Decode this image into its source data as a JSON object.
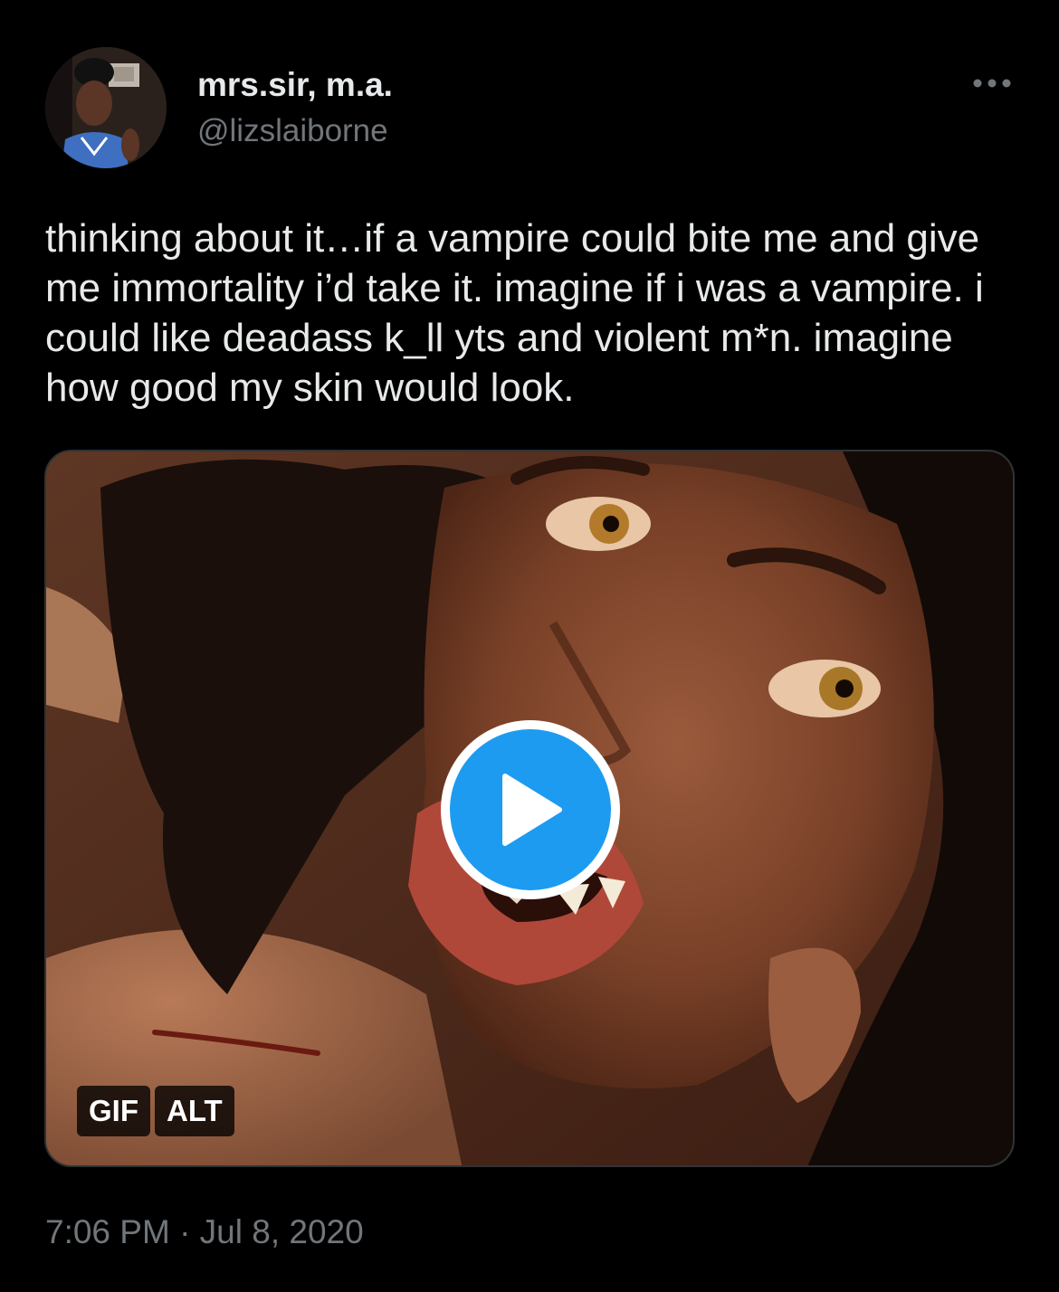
{
  "author": {
    "display_name": "mrs.sir, m.a.",
    "handle": "@lizslaiborne",
    "avatar_icon": "profile-photo"
  },
  "more_menu_icon": "more-horizontal-icon",
  "tweet": {
    "text": "thinking about it…if a vampire could bite me and give me immortality i’d take it. imagine if i was a vampire. i could like deadass k_ll yts and violent m*n. imagine how good my skin would look.",
    "timestamp": "7:06 PM · Jul 8, 2020"
  },
  "media": {
    "type": "gif",
    "play_icon": "play-icon",
    "gif_badge": "GIF",
    "alt_badge": "ALT"
  },
  "colors": {
    "background": "#000000",
    "text_primary": "#e7e9ea",
    "text_secondary": "#71767b",
    "accent": "#1d9bf0",
    "border": "#2f3336"
  }
}
